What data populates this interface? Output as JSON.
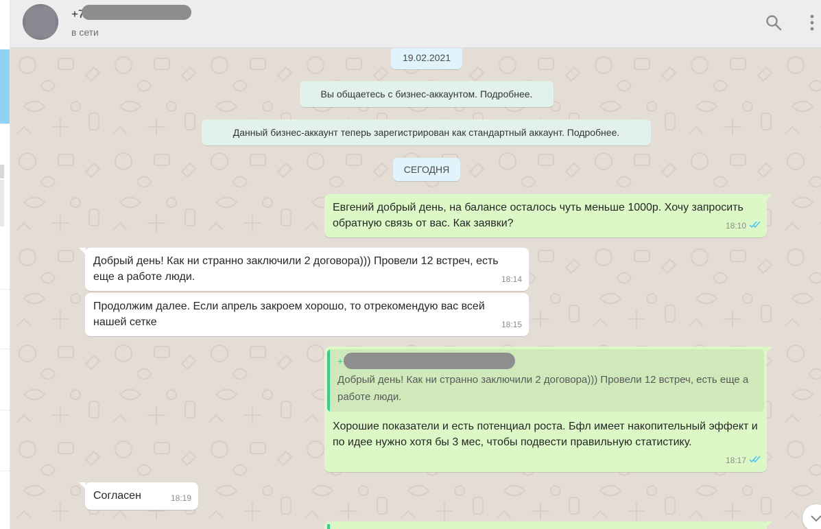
{
  "header": {
    "contact_name": "+7",
    "status": "в сети",
    "search_icon": "search-icon",
    "menu_icon": "more-vert-icon"
  },
  "chat": {
    "date_separator": "19.02.2021",
    "system_messages": [
      "Вы общаетесь с бизнес-аккаунтом. Подробнее.",
      "Данный бизнес-аккаунт теперь зарегистрирован как стандартный аккаунт. Подробнее."
    ],
    "today_separator": "СЕГОДНЯ",
    "messages": [
      {
        "direction": "out",
        "text": "Евгений добрый день, на балансе осталось чуть меньше 1000р. Хочу запросить обратную связь от вас. Как заявки?",
        "time": "18:10",
        "status": "read"
      },
      {
        "direction": "in",
        "text": "Добрый день! Как ни странно заключили 2 договора))) Провели 12 встреч, есть еще а работе люди.",
        "time": "18:14"
      },
      {
        "direction": "in",
        "text": "Продолжим далее. Если апрель закроем хорошо, то отрекомендую вас всей нашей сетке",
        "time": "18:15"
      },
      {
        "direction": "out",
        "quote": {
          "author": "+",
          "text": "Добрый день! Как ни странно заключили 2 договора))) Провели 12 встреч, есть еще а работе люди."
        },
        "text": "Хорошие показатели и есть потенциал роста. Бфл имеет накопительный эффект и по идее нужно хотя бы 3 мес, чтобы подвести правильную статистику.",
        "time": "18:17",
        "status": "read"
      },
      {
        "direction": "in",
        "text": "Согласен",
        "time": "18:19"
      }
    ]
  },
  "colors": {
    "outgoing_bubble": "#dcf8c6",
    "incoming_bubble": "#ffffff",
    "chat_background": "#e4ddd6",
    "read_ticks": "#4fc3f7",
    "quote_accent": "#35cd96"
  }
}
